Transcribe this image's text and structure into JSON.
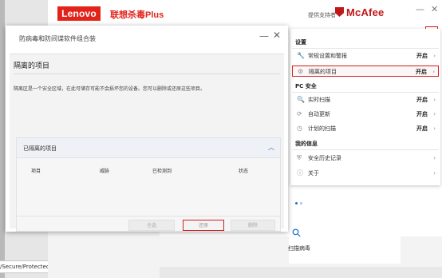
{
  "app": {
    "brand_logo": "Lenovo",
    "product_name": "联想杀毒Plus",
    "provided_by": "提供支持者",
    "partner_logo": "McAfee",
    "window_min": "—",
    "window_close": "✕"
  },
  "address_bar": {
    "path": "/Secure/Protected/Dash"
  },
  "menu": {
    "sections": [
      {
        "title": "设置",
        "items": [
          {
            "icon": "wrench-icon",
            "glyph": "🔧",
            "label": "常规设置和警报",
            "status": "开启",
            "highlighted": false
          },
          {
            "icon": "quarantine-icon",
            "glyph": "⚙",
            "label": "隔离的项目",
            "status": "开启",
            "highlighted": true
          }
        ]
      },
      {
        "title": "PC 安全",
        "items": [
          {
            "icon": "search-icon",
            "glyph": "🔍",
            "label": "实时扫描",
            "status": "开启"
          },
          {
            "icon": "refresh-icon",
            "glyph": "⟳",
            "label": "自动更新",
            "status": "开启"
          },
          {
            "icon": "calendar-icon",
            "glyph": "◷",
            "label": "计划的扫描",
            "status": "开启"
          }
        ]
      },
      {
        "title": "我的信息",
        "items": [
          {
            "icon": "shield-icon",
            "glyph": "⛨",
            "label": "安全历史记录",
            "status": ""
          },
          {
            "icon": "info-icon",
            "glyph": "ⓘ",
            "label": "关于",
            "status": ""
          }
        ]
      }
    ],
    "chevron": "›"
  },
  "dashboard": {
    "scan_label": "扫描病毒"
  },
  "dialog": {
    "title": "防病毒和防间谍软件组合装",
    "minimize": "—",
    "close": "✕",
    "heading": "隔离的项目",
    "description": "隔离区是一个安全区域，在此可储存可能不会损坏您的设备。您可以删除或还原这些项目。",
    "list": {
      "title": "已隔离的项目",
      "collapse_glyph": "︿",
      "columns": [
        "项目",
        "威胁",
        "已检测到",
        "状态"
      ],
      "buttons": {
        "select_all": "全选",
        "restore": "还原",
        "delete": "删除"
      }
    }
  },
  "colors": {
    "lenovo_red": "#e2231a",
    "mcafee_red": "#c01818",
    "highlight": "#d02020",
    "link_blue": "#2a5fb5"
  }
}
